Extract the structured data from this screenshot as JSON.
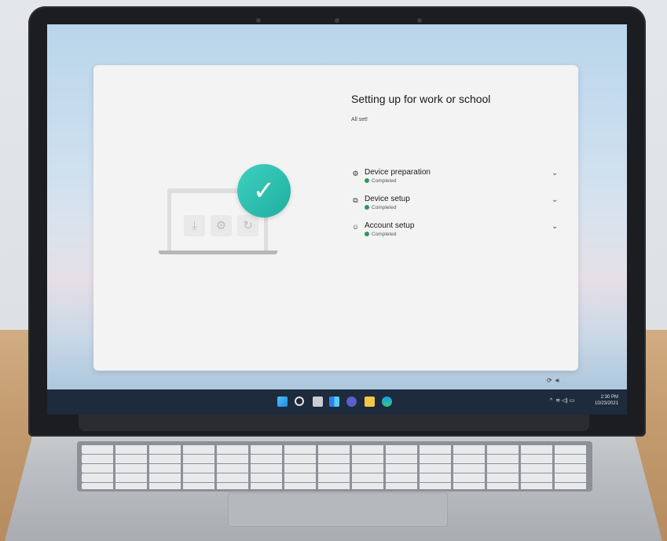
{
  "setup": {
    "title": "Setting up for work or school",
    "subtitle": "All set!",
    "steps": [
      {
        "name": "Device preparation",
        "status": "Completed",
        "icon": "gear-icon"
      },
      {
        "name": "Device setup",
        "status": "Completed",
        "icon": "devices-icon"
      },
      {
        "name": "Account setup",
        "status": "Completed",
        "icon": "people-icon"
      }
    ]
  },
  "taskbar": {
    "clock_time": "2:30 PM",
    "clock_date": "10/23/2021",
    "apps": [
      "windows-start-icon",
      "search-icon",
      "task-view-icon",
      "widgets-icon",
      "teams-chat-icon",
      "file-explorer-icon",
      "edge-icon"
    ]
  },
  "colors": {
    "accent_check": "#25bba9",
    "completed_dot": "#2b9a53",
    "taskbar": "#1d2b3c"
  }
}
